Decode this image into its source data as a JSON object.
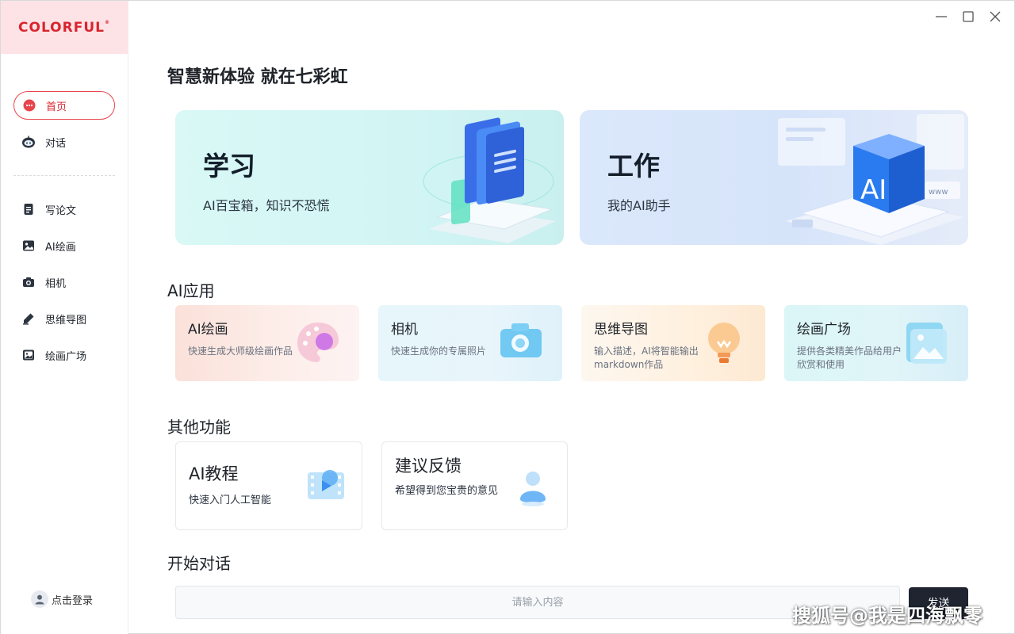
{
  "brand": {
    "logo_text": "COLORFUL",
    "logo_mark": "®",
    "accent_color": "#d9252e"
  },
  "sidebar": {
    "items": [
      {
        "label": "首页",
        "icon": "home-dots-icon",
        "active": true
      },
      {
        "label": "对话",
        "icon": "robot-icon",
        "active": false
      },
      {
        "label": "写论文",
        "icon": "document-icon",
        "active": false
      },
      {
        "label": "AI绘画",
        "icon": "image-icon",
        "active": false
      },
      {
        "label": "相机",
        "icon": "camera-icon",
        "active": false
      },
      {
        "label": "思维导图",
        "icon": "pen-icon",
        "active": false
      },
      {
        "label": "绘画广场",
        "icon": "gallery-icon",
        "active": false
      }
    ],
    "login_label": "点击登录"
  },
  "main": {
    "title": "智慧新体验 就在七彩虹",
    "hero": [
      {
        "title": "学习",
        "subtitle": "AI百宝箱，知识不恐慌"
      },
      {
        "title": "工作",
        "subtitle": "我的AI助手",
        "art_text": "AI",
        "art_small_text": "www"
      }
    ],
    "ai_apps": {
      "title": "AI应用",
      "cards": [
        {
          "title": "AI绘画",
          "desc": "快速生成大师级绘画作品",
          "icon": "palette-icon"
        },
        {
          "title": "相机",
          "desc": "快速生成你的专属照片",
          "icon": "camera-icon"
        },
        {
          "title": "思维导图",
          "desc": "输入描述，AI将智能输出markdown作品",
          "icon": "lightbulb-icon"
        },
        {
          "title": "绘画广场",
          "desc": "提供各类精美作品给用户欣赏和使用",
          "icon": "picture-folder-icon"
        }
      ]
    },
    "other": {
      "title": "其他功能",
      "cards": [
        {
          "title": "AI教程",
          "desc": "快速入门人工智能",
          "icon": "video-icon"
        },
        {
          "title": "建议反馈",
          "desc": "希望得到您宝贵的意见",
          "icon": "user-icon"
        }
      ]
    },
    "chat": {
      "title": "开始对话",
      "placeholder": "请输入内容",
      "send_label": "发送"
    }
  },
  "watermark": "搜狐号@我是四海飘零"
}
